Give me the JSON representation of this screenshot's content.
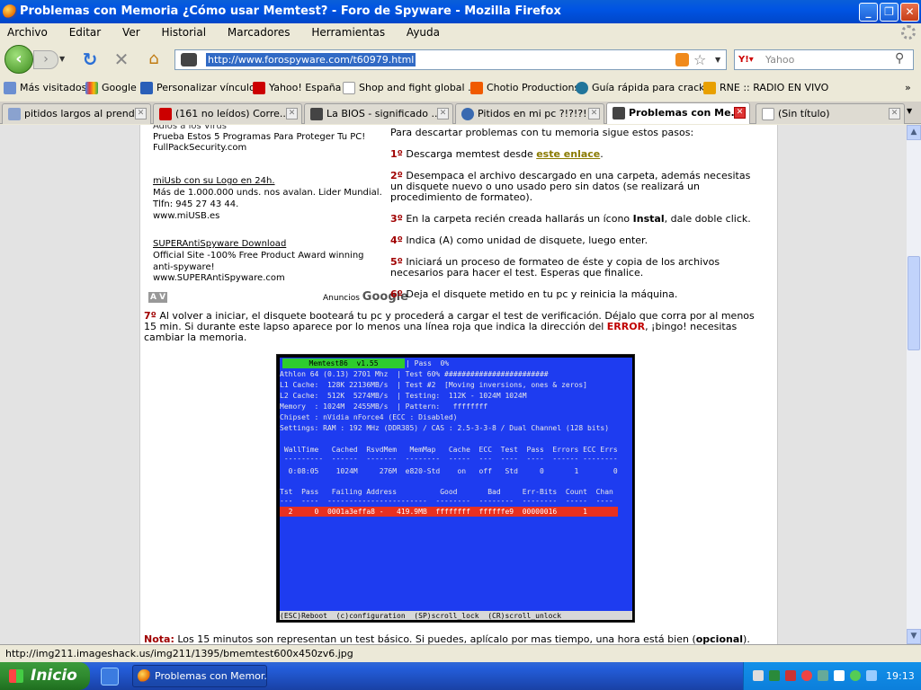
{
  "window": {
    "title": "Problemas con Memoria ¿Cómo usar Memtest? - Foro de Spyware - Mozilla Firefox"
  },
  "menu": [
    "Archivo",
    "Editar",
    "Ver",
    "Historial",
    "Marcadores",
    "Herramientas",
    "Ayuda"
  ],
  "nav": {
    "url": "http://www.forospyware.com/t60979.html",
    "search_placeholder": "Yahoo"
  },
  "bookmarks": [
    "Más visitados",
    "Google",
    "Personalizar vínculos",
    "Yahoo! España",
    "Shop and fight global ...",
    "Chotio Productions",
    "Guía rápida para crack...",
    "RNE :: RADIO EN VIVO"
  ],
  "tabs": [
    "pitidos largos al prend...",
    "(161 no leídos) Corre...",
    "La BIOS - significado ...",
    "Pitidos en mi pc ?!?!?! ...",
    "Problemas con Me...",
    "(Sin título)"
  ],
  "ads": {
    "top_partial": "Adios a los Virus",
    "ad1_body": "Prueba Estos 5 Programas Para Proteger Tu PC!",
    "ad1_url": "FullPackSecurity.com",
    "ad2_title": "miUsb con su Logo en 24h.",
    "ad2_body1": "Más de 1.000.000 unds. nos avalan. Lider Mundial.",
    "ad2_body2": "Tlfn: 945 27 43 44.",
    "ad2_url": "www.miUSB.es",
    "ad3_title": "SUPERAntiSpyware Download",
    "ad3_body1": "Official Site -100% Free Product Award winning",
    "ad3_body2": "anti-spyware!",
    "ad3_url": "www.SUPERAntiSpyware.com",
    "nav_arrows": "A V",
    "anuncios": "Anuncios",
    "google": "Google"
  },
  "steps": {
    "intro": "Para descartar problemas con tu memoria sigue estos pasos:",
    "s1_num": "1º",
    "s1_text": "Descarga memtest desde",
    "s1_link": "este enlace",
    "s2_num": "2º",
    "s2_l1": "Desempaca el archivo descargado en una carpeta, además necesitas",
    "s2_l2": "un disquete nuevo o uno usado pero sin datos (se realizará un",
    "s2_l3": "procedimiento de formateo).",
    "s3_num": "3º",
    "s3_a": "En la carpeta recién creada hallarás un ícono",
    "s3_b": "Instal",
    "s3_c": ", dale doble click.",
    "s4_num": "4º",
    "s4_text": "Indica (A) como unidad de disquete, luego enter.",
    "s5_num": "5º",
    "s5_l1": "Iniciará un proceso de formateo de éste y copia de los archivos",
    "s5_l2": "necesarios para hacer el test. Esperas que finalice.",
    "s6_num": "6º",
    "s6_text": "Deja el disquete metido en tu pc y reinicia la máquina.",
    "s7_num": "7º",
    "s7_l1": "Al volver a iniciar, el disquete booteará tu pc y procederá a cargar el test de verificación. Déjalo que corra por al menos",
    "s7_l2a": "15 min. Si durante este lapso aparece por lo menos una línea roja que indica la dirección del",
    "s7_err": "ERROR",
    "s7_l2b": ", ¡bingo! necesitas",
    "s7_l3": "cambiar la memoria.",
    "note_label": "Nota:",
    "note_a": "Los 15 minutos son representan un test básico. Si puedes, aplícalo por mas tiempo, una hora está bien (",
    "note_b": "opcional",
    "note_c": ")."
  },
  "memtest": {
    "header": "Memtest86  v1.55",
    "lines": [
      "Athlon 64 (0.13) 2701 Mhz  | Test 60% ########################",
      "L1 Cache:  128K 22136MB/s  | Test #2  [Moving inversions, ones & zeros]",
      "L2 Cache:  512K  5274MB/s  | Testing:  112K - 1024M 1024M",
      "Memory  : 1024M  2455MB/s  | Pattern:   ffffffff",
      "Chipset : nVidia nForce4 (ECC : Disabled)",
      "Settings: RAM : 192 MHz (DDR385) / CAS : 2.5-3-3-8 / Dual Channel (128 bits)"
    ],
    "pass_line": "| Pass  0%",
    "stats_header": " WallTime   Cached  RsvdMem   MemMap   Cache  ECC  Test  Pass  Errors ECC Errs",
    "stats_rule": " ---------  ------  -------  --------  -----  ---  ----  ----  ------ --------",
    "stats_values": "  0:08:05    1024M     276M  e820-Std    on   off   Std     0       1        0",
    "err_header": "Tst  Pass   Failing Address          Good       Bad     Err-Bits  Count  Chan",
    "err_rule": "---  ----  -----------------------  --------  --------  --------  -----  ----",
    "err_row": "  2     0  0001a3effa8 -   419.9MB  ffffffff  ffffffe9  00000016      1",
    "footer": "(ESC)Reboot  (c)configuration  (SP)scroll_lock  (CR)scroll_unlock"
  },
  "status": {
    "text": "http://img211.imageshack.us/img211/1395/bmemtest600x450zv6.jpg"
  },
  "taskbar": {
    "start": "Inicio",
    "task": "Problemas con Memor...",
    "clock": "19:13"
  },
  "colors": {
    "accent_red": "#a00000",
    "link": "#8a7a00",
    "memtest_bg": "#1e3cf0",
    "memtest_header": "#2ecc2e",
    "memtest_error": "#e83020"
  }
}
